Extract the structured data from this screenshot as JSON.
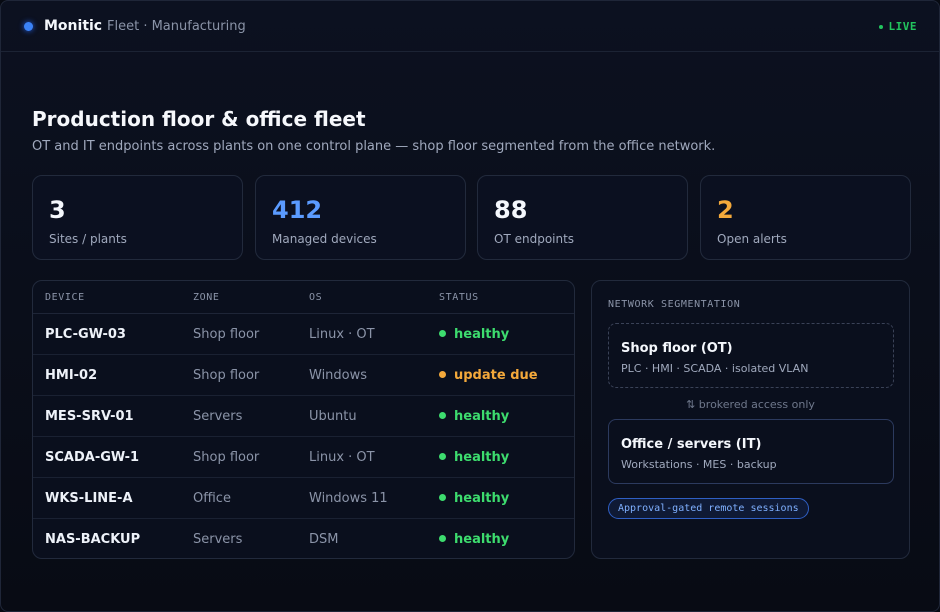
{
  "header": {
    "brand": "Monitic",
    "breadcrumb": "Fleet · Manufacturing",
    "live_label": "LIVE"
  },
  "page": {
    "title": "Production floor & office fleet",
    "subtitle": "OT and IT endpoints across plants on one control plane — shop floor segmented from the office network."
  },
  "stats": [
    {
      "value": "3",
      "label": "Sites / plants",
      "color": "#f4f7fc"
    },
    {
      "value": "412",
      "label": "Managed devices",
      "color": "#5b9bff"
    },
    {
      "value": "88",
      "label": "OT endpoints",
      "color": "#f4f7fc"
    },
    {
      "value": "2",
      "label": "Open alerts",
      "color": "#f4a93b"
    }
  ],
  "table": {
    "columns": [
      "DEVICE",
      "ZONE",
      "OS",
      "STATUS"
    ],
    "rows": [
      {
        "device": "PLC-GW-03",
        "zone": "Shop floor",
        "os": "Linux · OT",
        "status": "healthy",
        "status_color": "#3ddc6e"
      },
      {
        "device": "HMI-02",
        "zone": "Shop floor",
        "os": "Windows",
        "status": "update due",
        "status_color": "#f4a93b"
      },
      {
        "device": "MES-SRV-01",
        "zone": "Servers",
        "os": "Ubuntu",
        "status": "healthy",
        "status_color": "#3ddc6e"
      },
      {
        "device": "SCADA-GW-1",
        "zone": "Shop floor",
        "os": "Linux · OT",
        "status": "healthy",
        "status_color": "#3ddc6e"
      },
      {
        "device": "WKS-LINE-A",
        "zone": "Office",
        "os": "Windows 11",
        "status": "healthy",
        "status_color": "#3ddc6e"
      },
      {
        "device": "NAS-BACKUP",
        "zone": "Servers",
        "os": "DSM",
        "status": "healthy",
        "status_color": "#3ddc6e"
      }
    ]
  },
  "segmentation": {
    "title": "NETWORK SEGMENTATION",
    "ot_zone": {
      "title": "Shop floor (OT)",
      "detail": "PLC · HMI · SCADA · isolated VLAN"
    },
    "broker_note": "⇅ brokered access only",
    "it_zone": {
      "title": "Office / servers (IT)",
      "detail": "Workstations · MES · backup"
    },
    "pill": "Approval-gated remote sessions"
  }
}
